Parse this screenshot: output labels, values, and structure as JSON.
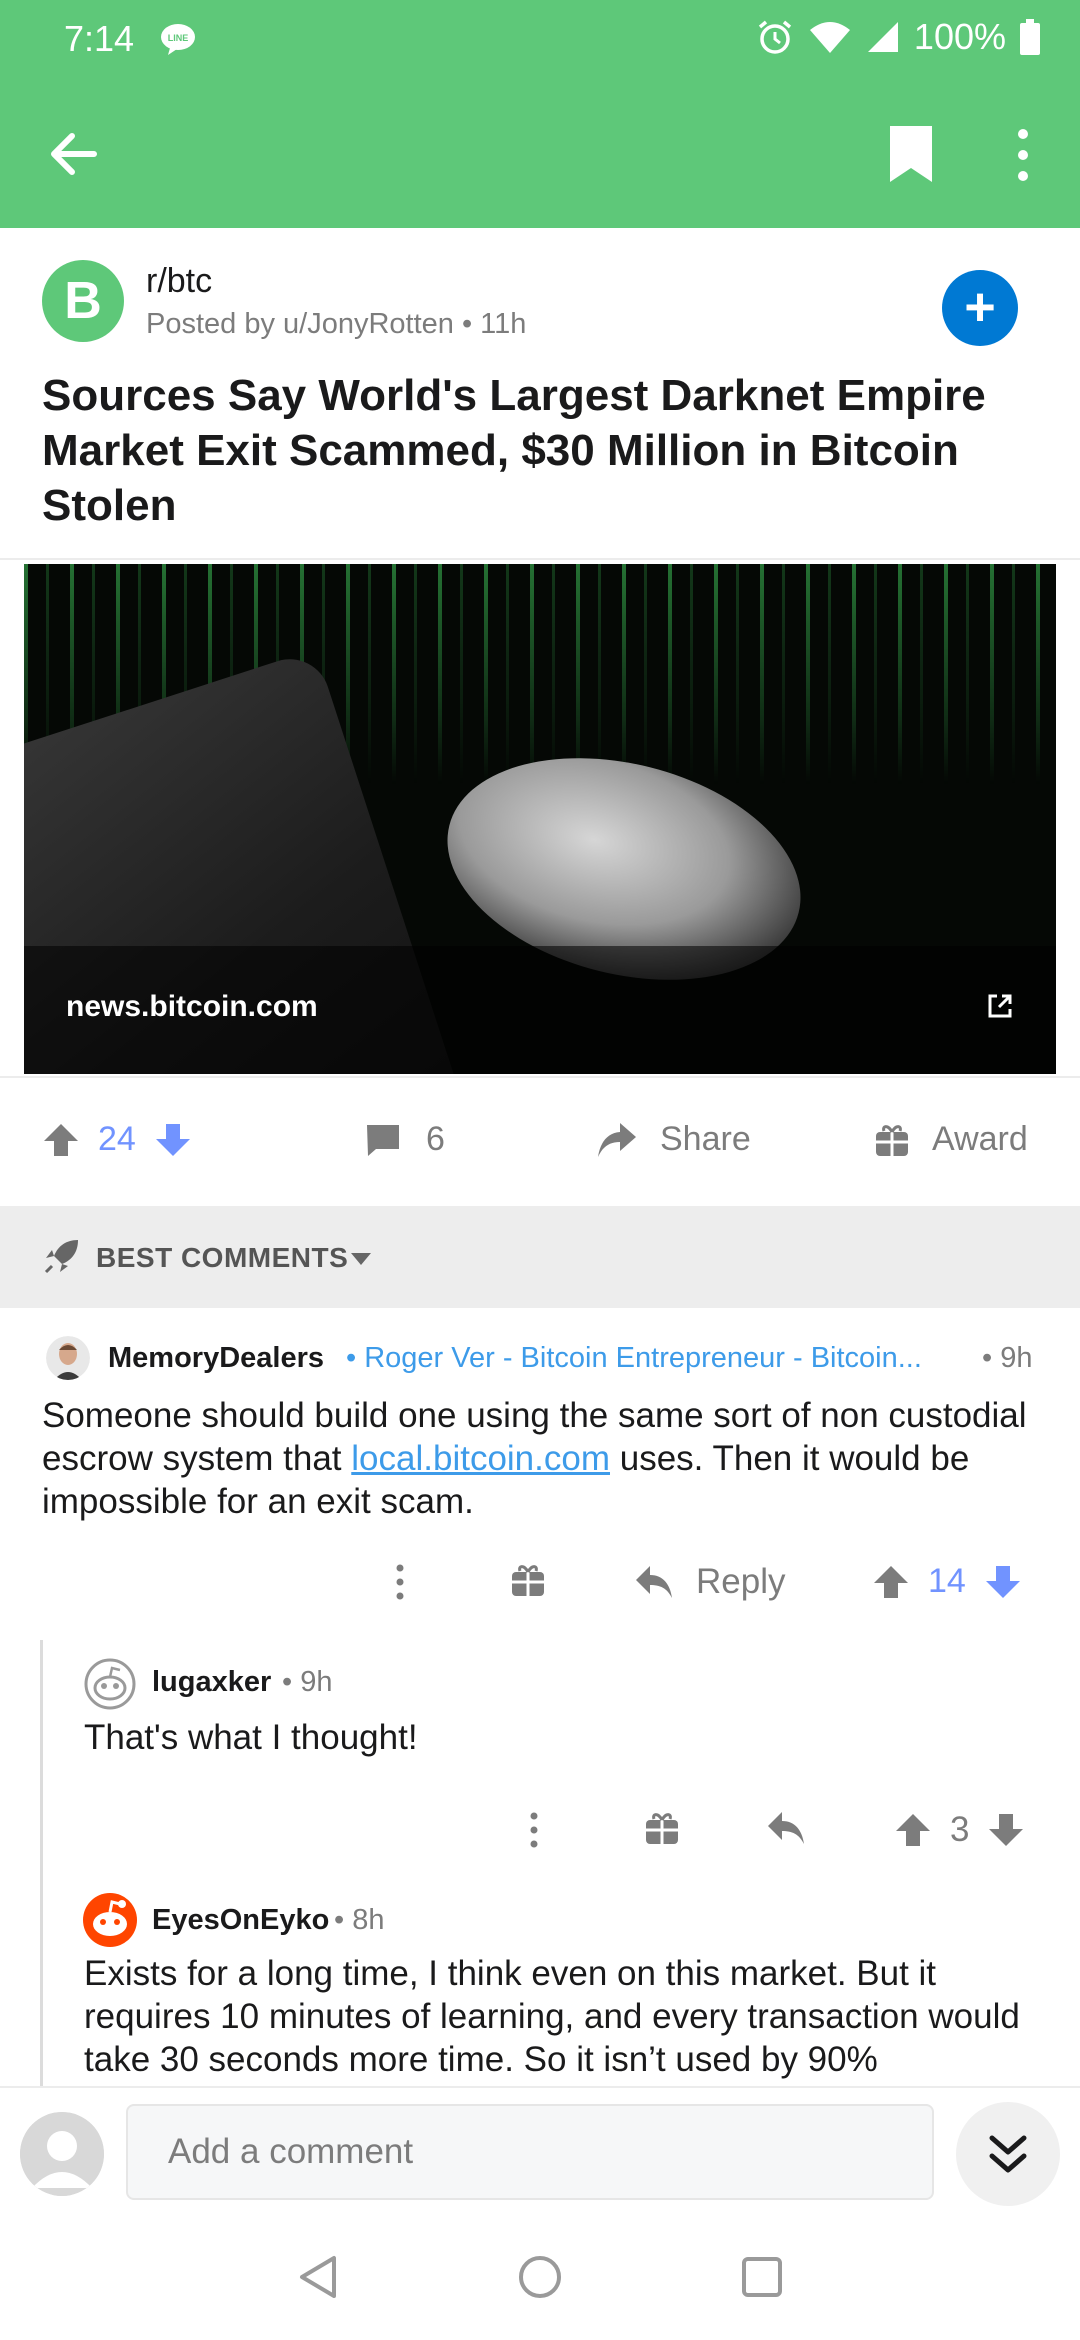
{
  "status_bar": {
    "time": "7:14",
    "battery": "100%"
  },
  "post": {
    "subreddit": "r/btc",
    "subreddit_avatar_letter": "B",
    "meta": "Posted by u/JonyRotten • 11h",
    "title": "Sources Say World's Largest Darknet Empire Market Exit Scammed, $30 Million in Bitcoin Stolen",
    "link_domain": "news.bitcoin.com",
    "votes": "24",
    "comments": "6",
    "share_label": "Share",
    "award_label": "Award"
  },
  "sort": {
    "label": "BEST COMMENTS"
  },
  "comments": [
    {
      "author": "MemoryDealers",
      "flair": "Roger Ver - Bitcoin Entrepreneur - Bitcoin...",
      "time": "• 9h",
      "body_pre": "Someone should build one using the same sort of non custodial escrow system that ",
      "body_link": "local.bitcoin.com",
      "body_post": " uses.  Then it would be impossible for an exit scam.",
      "reply_label": "Reply",
      "votes": "14"
    },
    {
      "author": "lugaxker",
      "time": "• 9h",
      "body": "That's what I thought!",
      "votes": "3"
    },
    {
      "author": "EyesOnEyko",
      "time": "• 8h",
      "body": "Exists for a long time, I think even on this market. But it requires 10 minutes of learning, and every transaction would take 30 seconds more time. So it isn’t used by 90%"
    }
  ],
  "composer": {
    "placeholder": "Add a comment"
  },
  "colors": {
    "accent": "#5ec879",
    "upvote_blue": "#7193ff",
    "link_blue": "#3d9be9",
    "join_blue": "#0079d3"
  }
}
